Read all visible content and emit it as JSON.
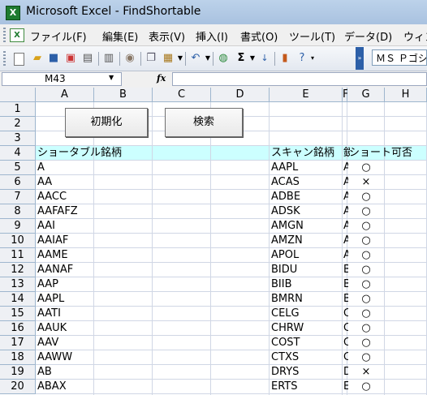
{
  "window": {
    "title": "Microsoft Excel - FindShortable",
    "app_icon": "excel-icon"
  },
  "menu": [
    "ファイル(F)",
    "編集(E)",
    "表示(V)",
    "挿入(I)",
    "書式(O)",
    "ツール(T)",
    "データ(D)",
    "ウィン"
  ],
  "toolbar": {
    "icons": [
      "new-document-icon",
      "open-folder-icon",
      "save-icon",
      "permission-icon",
      "print-preview-icon",
      "print-icon",
      "research-icon",
      "copy-icon",
      "paste-icon",
      "undo-icon",
      "hyperlink-icon",
      "autosum-icon",
      "sort-ascending-icon",
      "chart-wizard-icon",
      "help-icon"
    ],
    "autosum_glyph": "Σ",
    "font_name": "ＭＳ Ｐゴシック"
  },
  "formula_bar": {
    "name_box": "M43",
    "fx_label": "fx",
    "value": ""
  },
  "sheet": {
    "columns": [
      "A",
      "B",
      "C",
      "D",
      "E",
      "F",
      "G",
      "H"
    ],
    "rows": [
      "1",
      "2",
      "3",
      "4",
      "5",
      "6",
      "7",
      "8",
      "9",
      "10",
      "11",
      "12",
      "13",
      "14",
      "15",
      "16",
      "17",
      "18",
      "19",
      "20"
    ],
    "buttons": {
      "init": "初期化",
      "search": "検索"
    },
    "header": {
      "a": "ショータブル銘柄",
      "e": "スキャン銘柄",
      "f": "鏡",
      "g": "ショート可否"
    },
    "colors": {
      "header_fill": "#ccffff",
      "gridline": "#d0d7e5",
      "headings": "#eef0f4"
    },
    "data": [
      {
        "a": "A",
        "e": "AAPL",
        "f": "A",
        "g": "○"
      },
      {
        "a": "AA",
        "e": "ACAS",
        "f": "A",
        "g": "×"
      },
      {
        "a": "AACC",
        "e": "ADBE",
        "f": "A",
        "g": "○"
      },
      {
        "a": "AAFAFZ",
        "e": "ADSK",
        "f": "A",
        "g": "○"
      },
      {
        "a": "AAI",
        "e": "AMGN",
        "f": "A",
        "g": "○"
      },
      {
        "a": "AAIAF",
        "e": "AMZN",
        "f": "A",
        "g": "○"
      },
      {
        "a": "AAME",
        "e": "APOL",
        "f": "A",
        "g": "○"
      },
      {
        "a": "AANAF",
        "e": "BIDU",
        "f": "B",
        "g": "○"
      },
      {
        "a": "AAP",
        "e": "BIIB",
        "f": "B",
        "g": "○"
      },
      {
        "a": "AAPL",
        "e": "BMRN",
        "f": "B",
        "g": "○"
      },
      {
        "a": "AATI",
        "e": "CELG",
        "f": "C",
        "g": "○"
      },
      {
        "a": "AAUK",
        "e": "CHRW",
        "f": "C",
        "g": "○"
      },
      {
        "a": "AAV",
        "e": "COST",
        "f": "C",
        "g": "○"
      },
      {
        "a": "AAWW",
        "e": "CTXS",
        "f": "C",
        "g": "○"
      },
      {
        "a": "AB",
        "e": "DRYS",
        "f": "D",
        "g": "×"
      },
      {
        "a": "ABAX",
        "e": "ERTS",
        "f": "E",
        "g": "○"
      }
    ]
  }
}
